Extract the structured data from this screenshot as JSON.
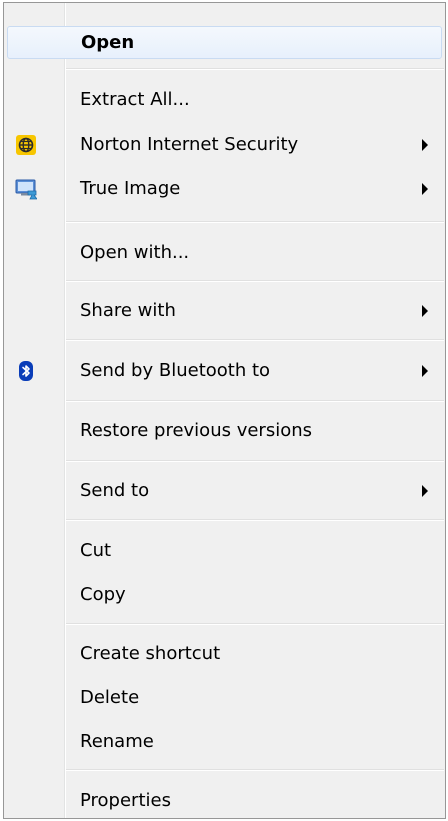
{
  "menu": {
    "open": "Open",
    "extract_all": "Extract All...",
    "norton": "Norton Internet Security",
    "true_image": "True Image",
    "open_with": "Open with...",
    "share_with": "Share with",
    "send_bluetooth": "Send by Bluetooth to",
    "restore_versions": "Restore previous versions",
    "send_to": "Send to",
    "cut": "Cut",
    "copy": "Copy",
    "create_shortcut": "Create shortcut",
    "delete": "Delete",
    "rename": "Rename",
    "properties": "Properties"
  },
  "icons": {
    "norton": "norton-globe-icon",
    "true_image": "true-image-monitor-icon",
    "bluetooth": "bluetooth-icon",
    "submenu": "submenu-arrow-icon"
  },
  "colors": {
    "menu_bg": "#f0f0f0",
    "highlight_bg": "#e7f0fc",
    "highlight_border": "#c9dbf2",
    "bluetooth_blue": "#0a3db8",
    "norton_yellow": "#f7c600"
  }
}
